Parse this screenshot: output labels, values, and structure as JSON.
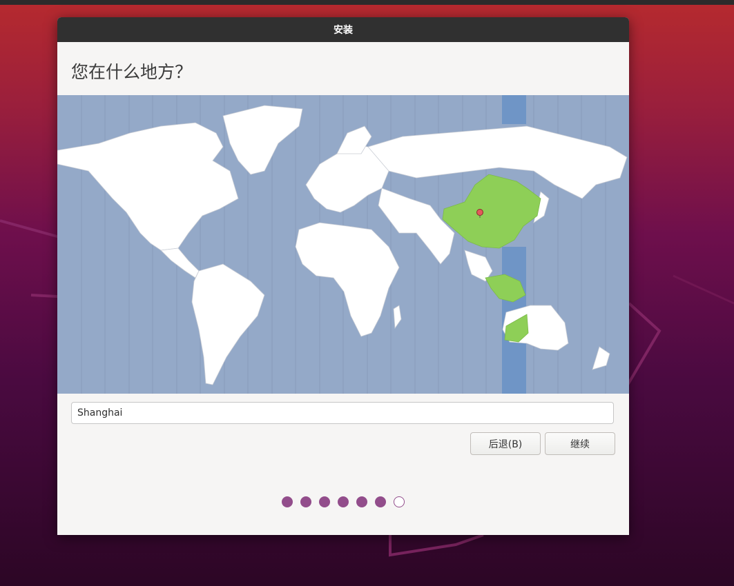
{
  "window": {
    "title": "安装"
  },
  "page": {
    "heading": "您在什么地方？"
  },
  "map": {
    "selected_timezone_region": "Asia",
    "marker_city": "Shanghai"
  },
  "location_input": {
    "value": "Shanghai"
  },
  "buttons": {
    "back_label": "后退(B)",
    "continue_label": "继续"
  },
  "progress": {
    "total_steps": 7,
    "completed_steps": 6
  },
  "colors": {
    "ocean": "#94a9c8",
    "land": "#ffffff",
    "selected_region": "#8ecf57",
    "timezone_band": "#6f95c6",
    "accent": "#924d8b"
  }
}
